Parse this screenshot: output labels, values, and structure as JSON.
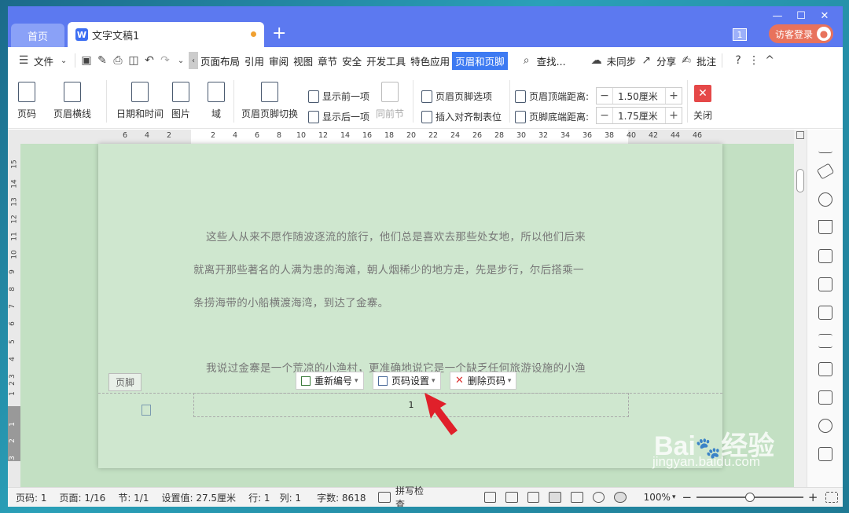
{
  "titlebar": {
    "home_tab": "首页",
    "doc_tab": "文字文稿1",
    "doc_logo": "W",
    "add_tab": "+",
    "badge": "1",
    "login": "访客登录",
    "minimize": "—",
    "maximize": "☐",
    "close": "✕"
  },
  "menubar": {
    "file": "文件",
    "items": [
      "页面布局",
      "引用",
      "审阅",
      "视图",
      "章节",
      "安全",
      "开发工具",
      "特色应用"
    ],
    "active": "页眉和页脚",
    "search": "查找...",
    "sync": "未同步",
    "share": "分享",
    "annotate": "批注",
    "help": "?",
    "more": "⋮",
    "collapse": "^"
  },
  "ribbon": {
    "page_number": "页码",
    "header_line": "页眉横线",
    "datetime": "日期和时间",
    "picture": "图片",
    "field": "域",
    "switch": "页眉页脚切换",
    "show_prev": "显示前一项",
    "show_next": "显示后一项",
    "same_section": "同前节",
    "options": "页眉页脚选项",
    "insert_tab": "插入对齐制表位",
    "header_top_label": "页眉顶端距离:",
    "header_top_value": "1.50厘米",
    "footer_bottom_label": "页脚底端距离:",
    "footer_bottom_value": "1.75厘米",
    "close": "关闭"
  },
  "ruler": {
    "h_numbers": [
      "6",
      "4",
      "2",
      "2",
      "4",
      "6",
      "8",
      "10",
      "12",
      "14",
      "16",
      "18",
      "20",
      "22",
      "24",
      "26",
      "28",
      "30",
      "32",
      "34",
      "36",
      "38",
      "40",
      "42",
      "44",
      "46"
    ],
    "v_numbers": [
      "15",
      "14",
      "13",
      "12",
      "11",
      "10",
      "9",
      "8",
      "7",
      "6",
      "5",
      "4",
      "3",
      "2",
      "1",
      "1",
      "2",
      "3"
    ]
  },
  "document": {
    "para1_line1": "这些人从来不愿作随波逐流的旅行，他们总是喜欢去那些处女地，所以他们后来",
    "para1_line2": "就离开那些著名的人满为患的海滩，朝人烟稀少的地方走，先是步行，尔后搭乘一",
    "para1_line3": "条捞海带的小船横渡海湾，到达了金寨。",
    "para2_line1": "我说过金寨是一个荒凉的小渔村，更准确地说它是一个缺乏任何旅游设施的小渔",
    "footer_label": "页脚",
    "page_number": "1"
  },
  "footer_toolbar": {
    "renumber": "重新编号",
    "page_setting": "页码设置",
    "delete": "删除页码"
  },
  "statusbar": {
    "page_code": "页码: 1",
    "page": "页面: 1/16",
    "section": "节: 1/1",
    "setting": "设置值: 27.5厘米",
    "row": "行: 1",
    "col": "列: 1",
    "words": "字数: 8618",
    "spell": "拼写检查",
    "zoom": "100%",
    "zoom_minus": "−",
    "zoom_plus": "+"
  },
  "watermark": {
    "line1": "Bai",
    "line1b": "经验",
    "line2": "jingyan.baidu.com"
  },
  "colors": {
    "titlebar": "#5c79f0",
    "active_tab": "#3d7af2",
    "page_bg": "#cfe7cf",
    "arrow": "#e0202a"
  }
}
